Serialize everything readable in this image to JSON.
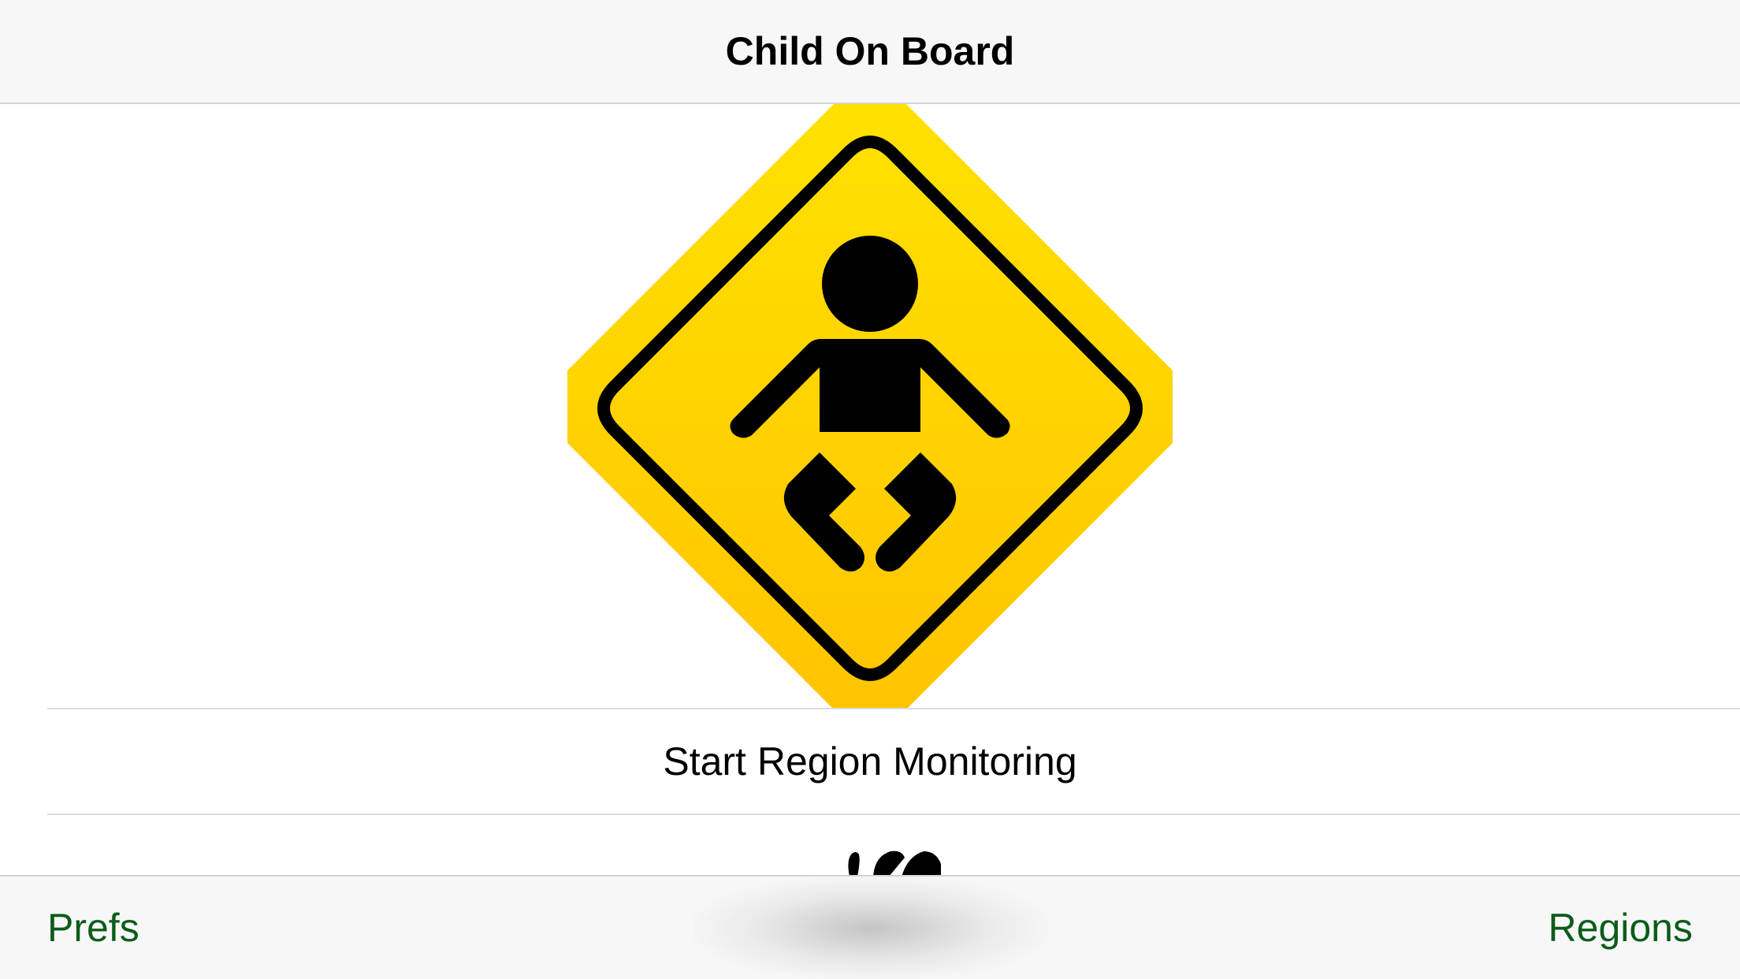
{
  "navbar": {
    "title": "Child On Board"
  },
  "main": {
    "sign_icon": "child-on-board-sign-icon",
    "start_button_label": "Start Region Monitoring",
    "peek_icon": "partial-icon"
  },
  "toolbar": {
    "left_label": "Prefs",
    "right_label": "Regions"
  },
  "colors": {
    "sign_yellow_top": "#FFE100",
    "sign_yellow_bottom": "#FFC400",
    "tint": "#0B5C1A"
  }
}
